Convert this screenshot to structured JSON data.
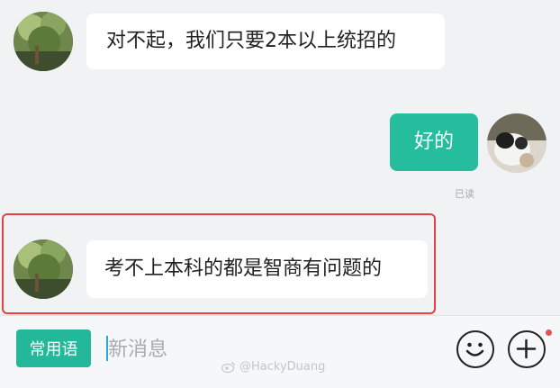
{
  "conversation": {
    "messages": [
      {
        "sender": "other",
        "text": "对不起，我们只要2本以上统招的"
      },
      {
        "sender": "me",
        "text": "好的",
        "status": "已读"
      },
      {
        "sender": "other",
        "text": "考不上本科的都是智商有问题的",
        "highlighted": true
      }
    ]
  },
  "composer": {
    "quick_phrases_label": "常用语",
    "input_placeholder": "新消息",
    "emoji_icon": "smiley-face-icon",
    "add_icon": "plus-circle-icon",
    "has_notification": true
  },
  "watermark": {
    "text": "@HackyDuang",
    "icon": "weibo-icon"
  },
  "colors": {
    "accent": "#25bd9e",
    "highlight_border": "#e64040",
    "notification_dot": "#e75151"
  }
}
